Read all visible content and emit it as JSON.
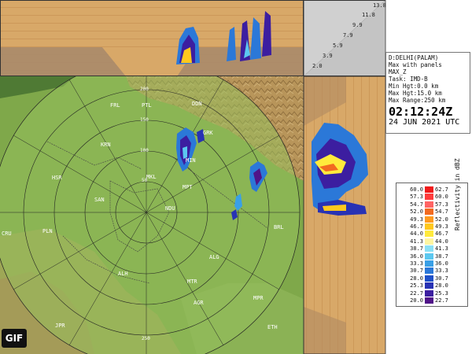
{
  "station": "D:DELHI(PALAM)",
  "product": "Max with panels",
  "product_code": "MAX_Z",
  "task": "Task: IMD-B",
  "min_height": "Min Hgt:0.0 km",
  "max_height": "Max Hgt:15.0 km",
  "max_range": "Max Range:250 km",
  "time": "02:12:24Z",
  "date": "24 JUN 2021 UTC",
  "height_scale": [
    "13.8",
    "11.8",
    "9.9",
    "7.9",
    "5.9",
    "3.9",
    "2.0"
  ],
  "range_labels": [
    "50",
    "100",
    "150",
    "200",
    "250"
  ],
  "map_places": [
    {
      "code": "DDN"
    },
    {
      "code": "GRK"
    },
    {
      "code": "MIN"
    },
    {
      "code": "MKL"
    },
    {
      "code": "MPT"
    },
    {
      "code": "KRN"
    },
    {
      "code": "HSR"
    },
    {
      "code": "SAN"
    },
    {
      "code": "NDU"
    },
    {
      "code": "CRU"
    },
    {
      "code": "PLN"
    },
    {
      "code": "ALG"
    },
    {
      "code": "BRL"
    },
    {
      "code": "ALH"
    },
    {
      "code": "MTR"
    },
    {
      "code": "AGR"
    },
    {
      "code": "MPR"
    },
    {
      "code": "JPR"
    },
    {
      "code": "ETH"
    },
    {
      "code": "PTL"
    },
    {
      "code": "FRL"
    }
  ],
  "legend": {
    "label": "Reflectivity in dBZ",
    "colors": {
      "background": "#ffffff",
      "land_green": "#8ab84f",
      "hill_brown": "#b5925a",
      "panel_tan": "#d6a86a"
    },
    "rows": [
      {
        "lo": "60.0",
        "hi": "62.7",
        "color": "#f01a1a"
      },
      {
        "lo": "57.3",
        "hi": "60.0",
        "color": "#ff3c3c"
      },
      {
        "lo": "54.7",
        "hi": "57.3",
        "color": "#ff6464"
      },
      {
        "lo": "52.0",
        "hi": "54.7",
        "color": "#f26a20"
      },
      {
        "lo": "49.3",
        "hi": "52.0",
        "color": "#ff9a1e"
      },
      {
        "lo": "46.7",
        "hi": "49.3",
        "color": "#ffc81e"
      },
      {
        "lo": "44.0",
        "hi": "46.7",
        "color": "#ffea3c"
      },
      {
        "lo": "41.3",
        "hi": "44.0",
        "color": "#fff5a0"
      },
      {
        "lo": "38.7",
        "hi": "41.3",
        "color": "#8be0f5"
      },
      {
        "lo": "36.0",
        "hi": "38.7",
        "color": "#5cc8f0"
      },
      {
        "lo": "33.3",
        "hi": "36.0",
        "color": "#3aa0e6"
      },
      {
        "lo": "30.7",
        "hi": "33.3",
        "color": "#2b78d8"
      },
      {
        "lo": "28.0",
        "hi": "30.7",
        "color": "#1e50c8"
      },
      {
        "lo": "25.3",
        "hi": "28.0",
        "color": "#2832b4"
      },
      {
        "lo": "22.7",
        "hi": "25.3",
        "color": "#3c1ea0"
      },
      {
        "lo": "20.0",
        "hi": "22.7",
        "color": "#501488"
      }
    ]
  },
  "badge": "GIF"
}
